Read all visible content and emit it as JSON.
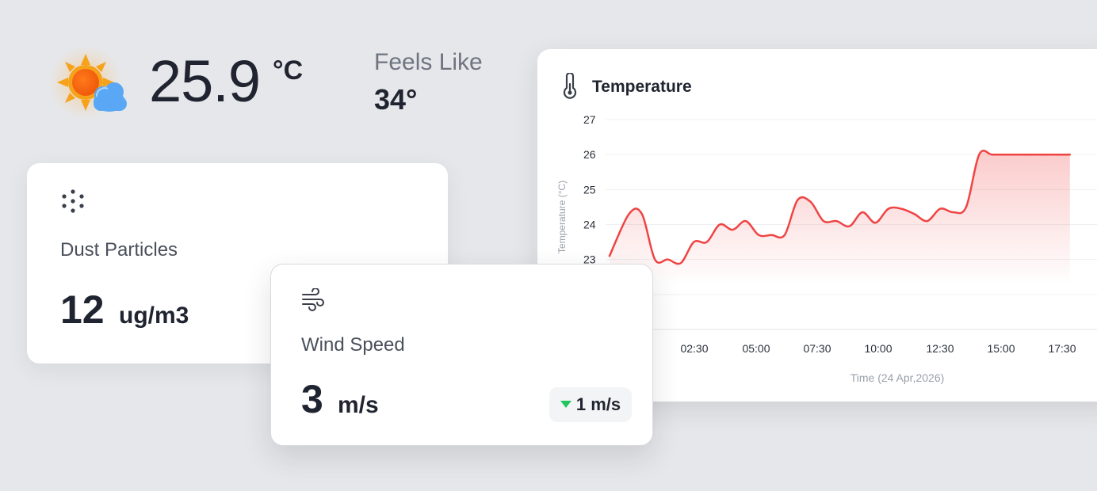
{
  "current": {
    "temperature": "25.9",
    "unit": "°C",
    "feels_like_label": "Feels Like",
    "feels_like_value": "34°",
    "icon": "partly-sunny-icon"
  },
  "dust": {
    "icon": "dots-icon",
    "label": "Dust Particles",
    "value": "12",
    "unit": "ug/m3"
  },
  "wind": {
    "icon": "wind-icon",
    "label": "Wind Speed",
    "value": "3",
    "unit": "m/s",
    "change": "1 m/s",
    "change_direction": "down",
    "change_color": "#22c55e"
  },
  "temperature_panel": {
    "title": "Temperature",
    "icon": "thermometer-icon"
  },
  "colors": {
    "line": "#ef4444",
    "background": "#e6e7ea",
    "card": "#ffffff"
  },
  "chart_data": {
    "type": "area",
    "xlabel": "Time (24 Apr,2026)",
    "ylabel": "Temperature (°C)",
    "x_ticks": [
      "02:30",
      "05:00",
      "07:30",
      "10:00",
      "12:30",
      "15:00",
      "17:30"
    ],
    "y_ticks": [
      27,
      26,
      25,
      24,
      23
    ],
    "ylim": [
      21,
      27
    ],
    "xlim": [
      "00:00",
      "18:00"
    ],
    "grid": true,
    "x": [
      "00:00",
      "00:45",
      "01:15",
      "01:45",
      "02:15",
      "02:45",
      "03:15",
      "03:45",
      "04:15",
      "04:45",
      "05:15",
      "05:45",
      "06:15",
      "06:45",
      "07:15",
      "07:45",
      "08:15",
      "08:45",
      "09:15",
      "09:45",
      "10:15",
      "10:45",
      "11:15",
      "11:45",
      "12:15",
      "12:45",
      "13:15",
      "13:45",
      "14:15",
      "14:45",
      "15:15",
      "15:45",
      "16:15",
      "16:45",
      "17:15",
      "17:45"
    ],
    "values": [
      23.1,
      24.3,
      24.3,
      23.0,
      23.0,
      22.9,
      23.5,
      23.5,
      24.0,
      23.85,
      24.1,
      23.7,
      23.7,
      23.7,
      24.7,
      24.65,
      24.1,
      24.1,
      23.95,
      24.35,
      24.05,
      24.45,
      24.45,
      24.3,
      24.1,
      24.45,
      24.35,
      24.5,
      26.0,
      26.0,
      26.0,
      26.0,
      26.0,
      26.0,
      26.0,
      26.0
    ]
  }
}
